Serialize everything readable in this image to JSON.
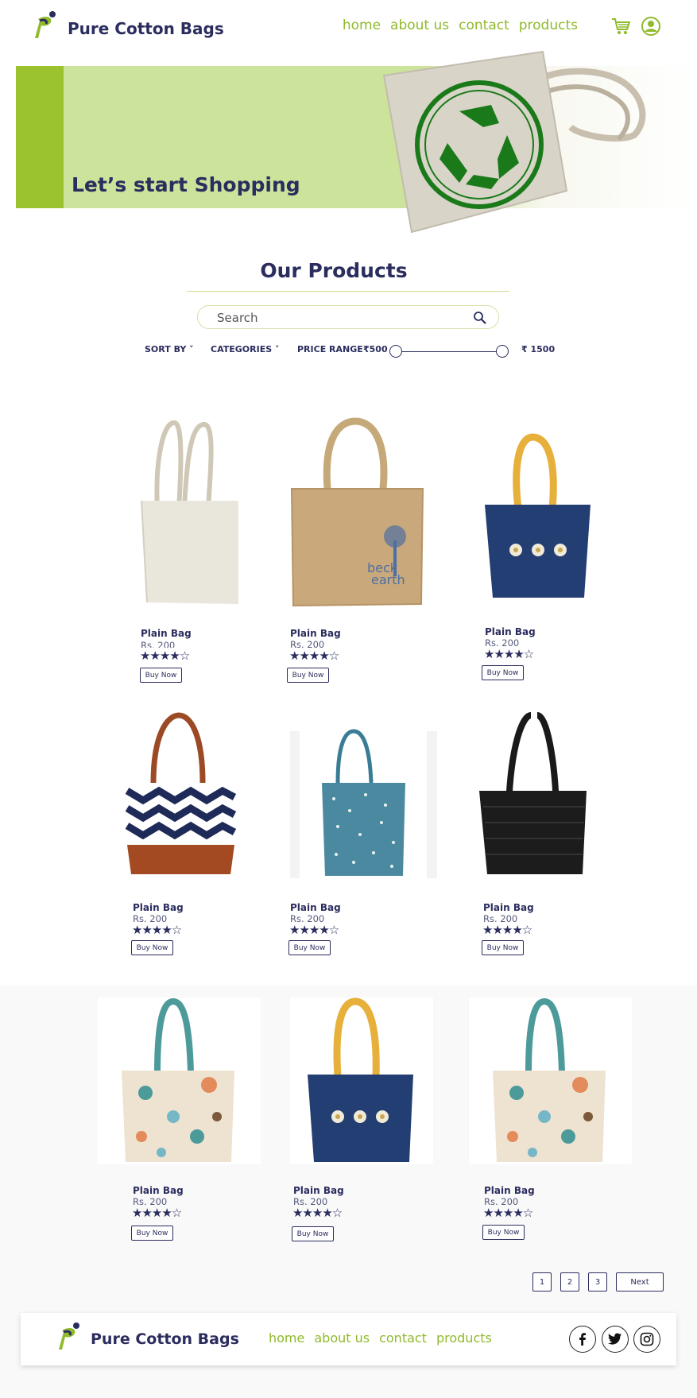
{
  "header": {
    "brand": "Pure Cotton Bags",
    "nav": [
      "home",
      "about us",
      "contact",
      "products"
    ],
    "icons": [
      "cart-icon",
      "user-icon"
    ]
  },
  "banner": {
    "title": "Let’s start Shopping"
  },
  "products_section": {
    "title": "Our Products",
    "search_placeholder": "Search",
    "sort_label": "SORT BY ˅",
    "categories_label": "CATEGORIES ˅",
    "price_range_label": "PRICE RANGE",
    "price_min": "₹500",
    "price_max": "₹ 1500"
  },
  "products": [
    {
      "name": "Plain Bag",
      "price": "Rs. 200",
      "rating": 4,
      "stars": "★★★★☆",
      "button": "Buy Now"
    },
    {
      "name": "Plain Bag",
      "price": "Rs. 200",
      "rating": 4,
      "stars": "★★★★☆",
      "button": "Buy Now"
    },
    {
      "name": "Plain Bag",
      "price": "Rs. 200",
      "rating": 4,
      "stars": "★★★★☆",
      "button": "Buy Now"
    },
    {
      "name": "Plain Bag",
      "price": "Rs. 200",
      "rating": 4,
      "stars": "★★★★☆",
      "button": "Buy Now"
    },
    {
      "name": "Plain Bag",
      "price": "Rs. 200",
      "rating": 4,
      "stars": "★★★★☆",
      "button": "Buy Now"
    },
    {
      "name": "Plain Bag",
      "price": "Rs. 200",
      "rating": 4,
      "stars": "★★★★☆",
      "button": "Buy Now"
    },
    {
      "name": "Plain Bag",
      "price": "Rs. 200",
      "rating": 4,
      "stars": "★★★★☆",
      "button": "Buy Now"
    },
    {
      "name": "Plain Bag",
      "price": "Rs. 200",
      "rating": 4,
      "stars": "★★★★☆",
      "button": "Buy Now"
    },
    {
      "name": "Plain Bag",
      "price": "Rs. 200",
      "rating": 4,
      "stars": "★★★★☆",
      "button": "Buy Now"
    }
  ],
  "pagination": {
    "pages": [
      "1",
      "2",
      "3"
    ],
    "next": "Next"
  },
  "footer": {
    "brand": "Pure Cotton Bags",
    "nav": [
      "home",
      "about us",
      "contact",
      "products"
    ],
    "social": [
      "facebook-icon",
      "twitter-icon",
      "instagram-icon"
    ]
  },
  "colors": {
    "navy": "#2b2d5e",
    "green": "#8fba2b",
    "banner_green": "#cce39b",
    "accent_strip": "#9ac32e"
  }
}
